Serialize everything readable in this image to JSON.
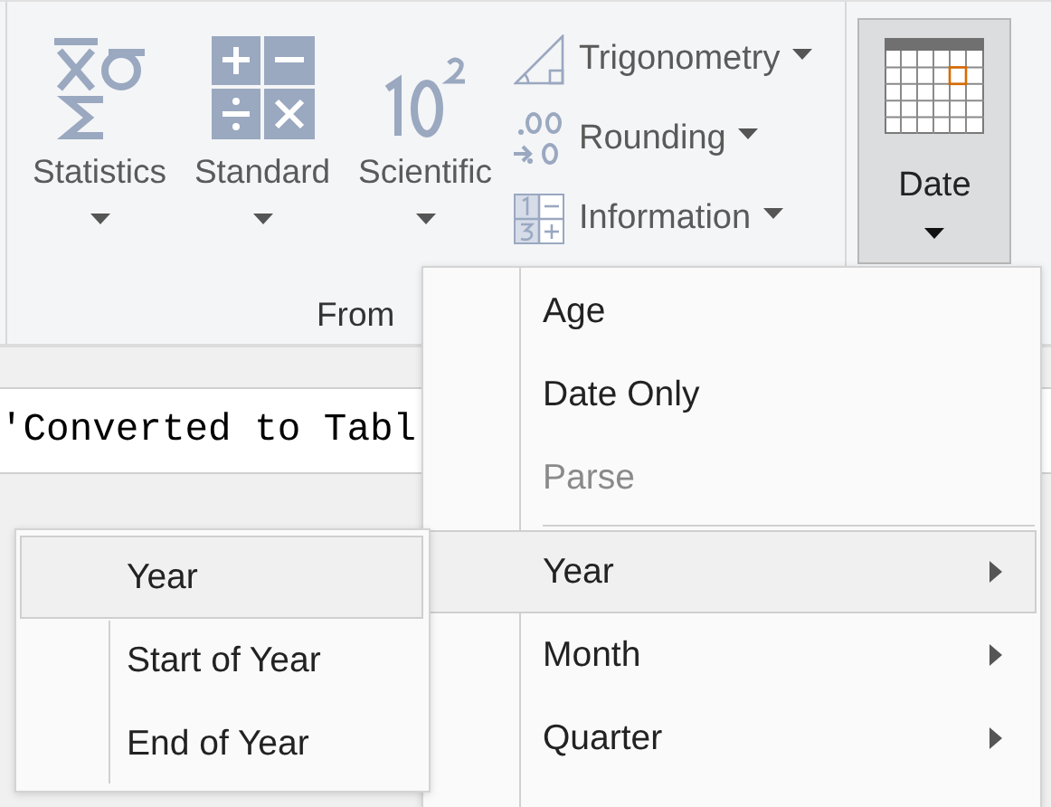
{
  "ribbon": {
    "large_buttons": [
      {
        "label": "Statistics",
        "kind": "statistics"
      },
      {
        "label": "Standard",
        "kind": "standard"
      },
      {
        "label": "Scientific",
        "kind": "scientific"
      }
    ],
    "small_buttons": [
      {
        "label": "Trigonometry",
        "kind": "trigonometry"
      },
      {
        "label": "Rounding",
        "kind": "rounding"
      },
      {
        "label": "Information",
        "kind": "information"
      }
    ],
    "group_label": "From",
    "date_button": {
      "label": "Date",
      "selected": true
    }
  },
  "formula_bar": {
    "value": "'Converted to Tabl"
  },
  "menu": {
    "items": [
      {
        "label": "Age",
        "kind": "item",
        "disabled": false,
        "selected": false
      },
      {
        "label": "Date Only",
        "kind": "item",
        "disabled": false,
        "selected": false
      },
      {
        "label": "Parse",
        "kind": "item",
        "disabled": true,
        "selected": false
      },
      {
        "kind": "separator"
      },
      {
        "label": "Year",
        "kind": "submenu",
        "disabled": false,
        "selected": true
      },
      {
        "label": "Month",
        "kind": "submenu",
        "disabled": false,
        "selected": false
      },
      {
        "label": "Quarter",
        "kind": "submenu",
        "disabled": false,
        "selected": false
      }
    ]
  },
  "submenu": {
    "items": [
      {
        "label": "Year",
        "selected": true
      },
      {
        "label": "Start of Year",
        "selected": false
      },
      {
        "label": "End of Year",
        "selected": false
      }
    ]
  }
}
